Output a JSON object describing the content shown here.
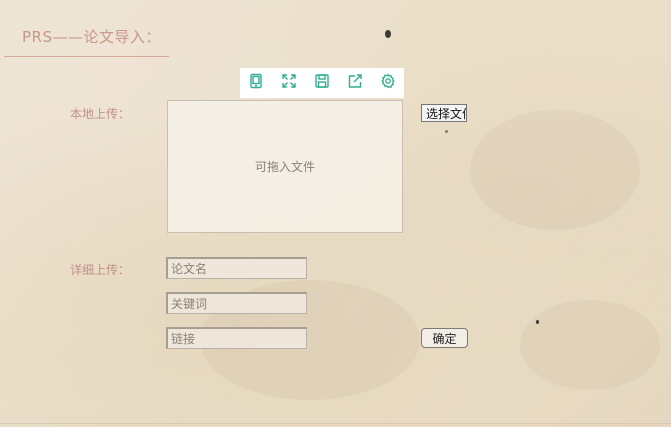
{
  "header": {
    "title": "PRS——论文导入："
  },
  "toolbar": {
    "items": [
      {
        "icon": "tablet-icon"
      },
      {
        "icon": "fullscreen-icon"
      },
      {
        "icon": "save-icon"
      },
      {
        "icon": "share-icon"
      },
      {
        "icon": "gear-icon"
      }
    ],
    "icon_color": "#2fae8e"
  },
  "local_upload": {
    "label": "本地上传：",
    "dropzone_text": "可拖入文件",
    "file_button_label": "选择文件"
  },
  "detail_upload": {
    "label": "详细上传：",
    "fields": {
      "paper_name_placeholder": "论文名",
      "keywords_placeholder": "关键词",
      "link_placeholder": "链接"
    },
    "confirm_label": "确定"
  },
  "colors": {
    "label": "#c2918a",
    "title": "#c9968a",
    "background": "#ebe0cc"
  }
}
